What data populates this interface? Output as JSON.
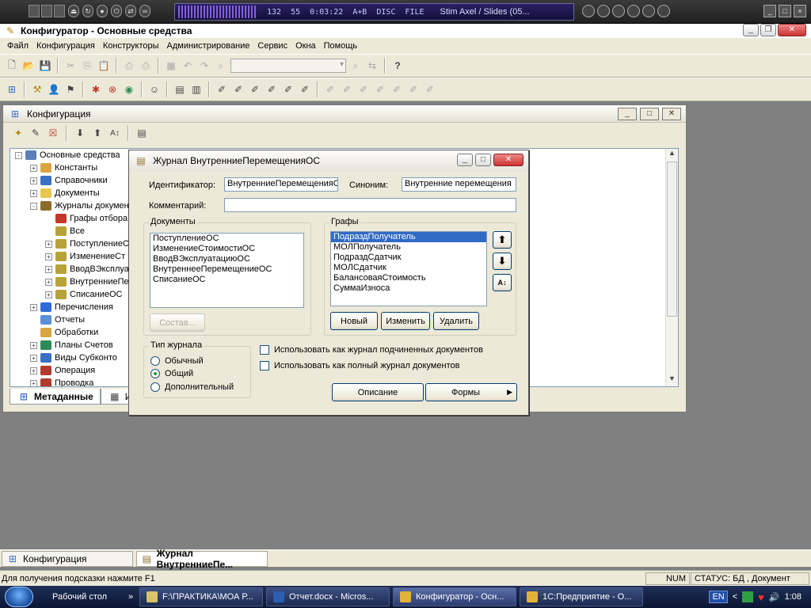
{
  "media": {
    "time_a": "132",
    "time_b": "55",
    "elapsed": "0:03:22",
    "mode": "A+B",
    "disc": "DISC",
    "file": "FILE",
    "track": "Stim Axel / Slides  (05..."
  },
  "app": {
    "title": "Конфигуратор - Основные средства"
  },
  "menu": [
    "Файл",
    "Конфигурация",
    "Конструкторы",
    "Администрирование",
    "Сервис",
    "Окна",
    "Помощь"
  ],
  "config_window": {
    "title": "Конфигурация",
    "tree": [
      {
        "label": "Основные средства",
        "level": 0,
        "toggle": "-",
        "color": "#5a7fb8"
      },
      {
        "label": "Константы",
        "level": 1,
        "toggle": "+",
        "color": "#d9a441"
      },
      {
        "label": "Справочники",
        "level": 1,
        "toggle": "+",
        "color": "#3a6fc4"
      },
      {
        "label": "Документы",
        "level": 1,
        "toggle": "+",
        "color": "#e6c84f"
      },
      {
        "label": "Журналы докумен",
        "level": 1,
        "toggle": "-",
        "color": "#8a6d2b"
      },
      {
        "label": "Графы отбора",
        "level": 2,
        "toggle": "",
        "color": "#c0392b"
      },
      {
        "label": "Все",
        "level": 2,
        "toggle": "",
        "color": "#b8a23a"
      },
      {
        "label": "ПоступлениеО",
        "level": 2,
        "toggle": "+",
        "color": "#b8a23a"
      },
      {
        "label": "ИзменениеСт",
        "level": 2,
        "toggle": "+",
        "color": "#b8a23a"
      },
      {
        "label": "ВводВЭксплуа",
        "level": 2,
        "toggle": "+",
        "color": "#b8a23a"
      },
      {
        "label": "ВнутренниеПе",
        "level": 2,
        "toggle": "+",
        "color": "#b8a23a"
      },
      {
        "label": "СписаниеОС",
        "level": 2,
        "toggle": "+",
        "color": "#b8a23a"
      },
      {
        "label": "Перечисления",
        "level": 1,
        "toggle": "+",
        "color": "#2f6bd8"
      },
      {
        "label": "Отчеты",
        "level": 1,
        "toggle": "",
        "color": "#5b8fd6"
      },
      {
        "label": "Обработки",
        "level": 1,
        "toggle": "",
        "color": "#d9a441"
      },
      {
        "label": "Планы Счетов",
        "level": 1,
        "toggle": "+",
        "color": "#2e8b57"
      },
      {
        "label": "Виды Субконто",
        "level": 1,
        "toggle": "+",
        "color": "#3a6fc4"
      },
      {
        "label": "Операция",
        "level": 1,
        "toggle": "+",
        "color": "#b03a2e"
      },
      {
        "label": "Проводка",
        "level": 1,
        "toggle": "+",
        "color": "#b03a2e"
      }
    ],
    "tabs": [
      "Метаданные",
      "И"
    ]
  },
  "dialog": {
    "title": "Журнал ВнутренниеПеремещенияОС",
    "id_label": "Идентификатор:",
    "id_value": "ВнутренниеПеремещенияО",
    "synonym_label": "Синоним:",
    "synonym_value": "Внутренние перемещения",
    "comment_label": "Комментарий:",
    "comment_value": "",
    "docs_group": "Документы",
    "docs": [
      "ПоступлениеОС",
      "ИзменениеСтоимостиОС",
      "ВводВЭксплуатациюОС",
      "ВнутреннееПеремещениеОС",
      "СписаниеОС"
    ],
    "compose_button": "Состав...",
    "graphs_group": "Графы",
    "graphs": [
      "ПодраздПолучатель",
      "МОЛПолучатель",
      "ПодраздСдатчик",
      "МОЛСдатчик",
      "БалансоваяСтоимость",
      "СуммаИзноса"
    ],
    "new_button": "Новый",
    "edit_button": "Изменить",
    "delete_button": "Удалить",
    "type_group": "Тип журнала",
    "types": [
      "Обычный",
      "Общий",
      "Дополнительный"
    ],
    "selected_type": 1,
    "check_subordinate": "Использовать как журнал подчиненных документов",
    "check_full": "Использовать как полный журнал  документов",
    "description_button": "Описание",
    "forms_button": "Формы"
  },
  "window_tabs": [
    "Конфигурация",
    "Журнал ВнутренниеПе..."
  ],
  "status": {
    "hint": "Для получения подсказки нажмите F1",
    "num": "NUM",
    "state": "СТАТУС: БД , Документ"
  },
  "taskbar": {
    "desktop": "Рабочий стол",
    "tasks": [
      "F:\\ПРАКТИКА\\МОА Р...",
      "Отчет.docx - Micros...",
      "Конфигуратор - Осн...",
      "1С:Предприятие - О..."
    ],
    "active_task": 2,
    "lang": "EN",
    "clock": "1:08"
  }
}
